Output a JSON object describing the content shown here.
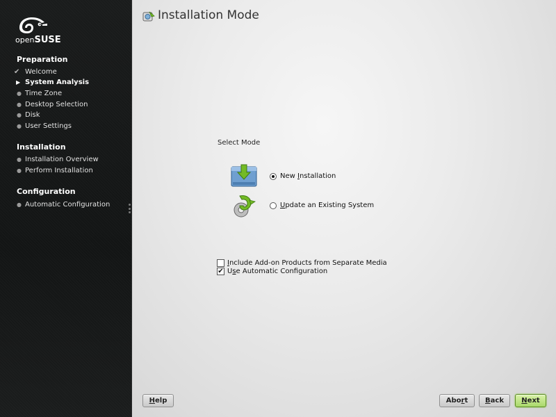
{
  "brand": {
    "logo_light": "open",
    "logo_bold": "SUSE"
  },
  "sidebar": {
    "sections": [
      {
        "title": "Preparation",
        "steps": [
          {
            "label": "Welcome",
            "state": "done"
          },
          {
            "label": "System Analysis",
            "state": "current"
          },
          {
            "label": "Time Zone",
            "state": "pending"
          },
          {
            "label": "Desktop Selection",
            "state": "pending"
          },
          {
            "label": "Disk",
            "state": "pending"
          },
          {
            "label": "User Settings",
            "state": "pending"
          }
        ]
      },
      {
        "title": "Installation",
        "steps": [
          {
            "label": "Installation Overview",
            "state": "pending"
          },
          {
            "label": "Perform Installation",
            "state": "pending"
          }
        ]
      },
      {
        "title": "Configuration",
        "steps": [
          {
            "label": "Automatic Configuration",
            "state": "pending"
          }
        ]
      }
    ]
  },
  "main": {
    "title": "Installation Mode",
    "title_icon": "yast-installer-icon",
    "select_mode_label": "Select Mode",
    "modes": [
      {
        "pre": "New ",
        "accel": "I",
        "post": "nstallation",
        "checked": true,
        "icon": "new-installation-icon"
      },
      {
        "pre": "",
        "accel": "U",
        "post": "pdate an Existing System",
        "checked": false,
        "icon": "update-system-icon"
      }
    ],
    "options": [
      {
        "pre": "",
        "accel": "I",
        "post": "nclude Add-on Products from Separate Media",
        "checked": false
      },
      {
        "pre": "U",
        "accel": "s",
        "post": "e Automatic Configuration",
        "checked": true
      }
    ]
  },
  "buttons": {
    "help": {
      "pre": "",
      "accel": "H",
      "post": "elp"
    },
    "abort": {
      "pre": "Abo",
      "accel": "r",
      "post": "t"
    },
    "back": {
      "pre": "",
      "accel": "B",
      "post": "ack"
    },
    "next": {
      "pre": "",
      "accel": "N",
      "post": "ext"
    }
  },
  "colors": {
    "sidebar_bg": "#161818",
    "accent_green": "#73ba25",
    "next_button": "#b5de78"
  }
}
